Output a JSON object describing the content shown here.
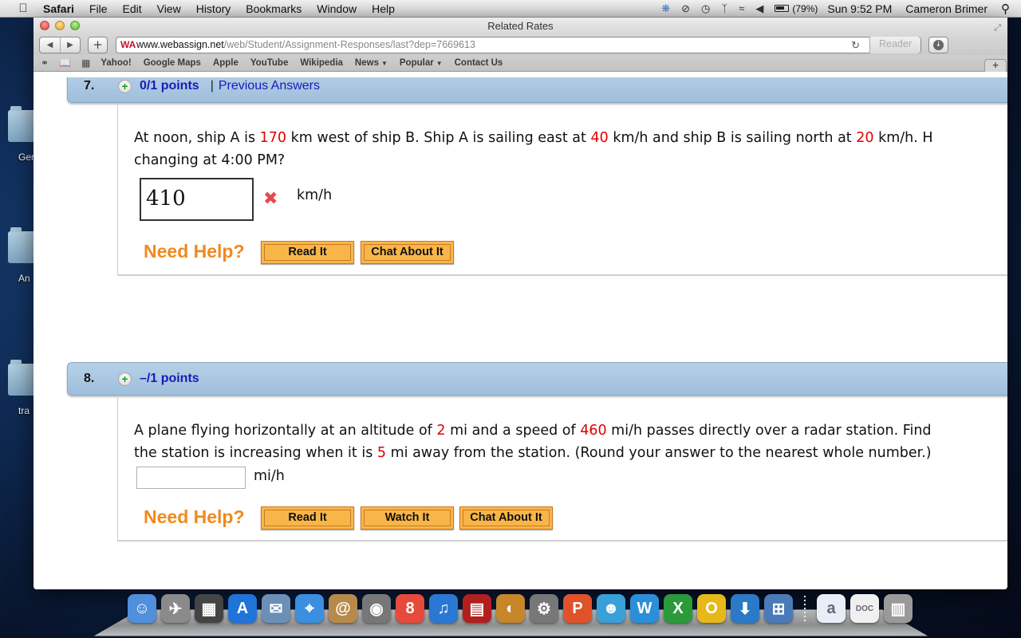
{
  "menubar": {
    "app_name": "Safari",
    "items": [
      "File",
      "Edit",
      "View",
      "History",
      "Bookmarks",
      "Window",
      "Help"
    ],
    "battery": "(79%)",
    "clock": "Sun 9:52 PM",
    "user": "Cameron Brimer"
  },
  "desktop": {
    "icons": [
      {
        "label": "Ger"
      },
      {
        "label": "An"
      },
      {
        "label": "tra"
      }
    ]
  },
  "browser": {
    "title": "Related Rates",
    "url_domain": "www.webassign.net",
    "url_path": "/web/Student/Assignment-Responses/last?dep=7669613",
    "reader_label": "Reader",
    "bookmarks": [
      {
        "label": "Yahoo!"
      },
      {
        "label": "Google Maps"
      },
      {
        "label": "Apple"
      },
      {
        "label": "YouTube"
      },
      {
        "label": "Wikipedia"
      },
      {
        "label": "News",
        "has_menu": true
      },
      {
        "label": "Popular",
        "has_menu": true
      },
      {
        "label": "Contact Us"
      }
    ]
  },
  "questions": [
    {
      "number": "7.",
      "points": "0/1 points",
      "separator": "|",
      "previous_answers": "Previous Answers",
      "text": {
        "p1": "At noon, ship A is ",
        "v1": "170",
        "p2": " km west of ship B. Ship A is sailing east at ",
        "v2": "40",
        "p3": " km/h and ship B is sailing north at ",
        "v3": "20",
        "p4": " km/h. H",
        "line2": "changing at 4:00 PM?"
      },
      "answer_value": "410",
      "answer_status": "incorrect",
      "unit": "km/h",
      "need_help": "Need Help?",
      "help_buttons": [
        "Read It",
        "Chat About It"
      ]
    },
    {
      "number": "8.",
      "points": "–/1 points",
      "text": {
        "p1": "A plane flying horizontally at an altitude of ",
        "v1": "2",
        "p2": " mi and a speed of ",
        "v2": "460",
        "p3": " mi/h passes directly over a radar station. Find",
        "l2a": "the station is increasing when it is ",
        "v3": "5",
        "l2b": " mi away from the station. (Round your answer to the nearest whole number.)"
      },
      "answer_value": "",
      "unit": "mi/h",
      "need_help": "Need Help?",
      "help_buttons": [
        "Read It",
        "Watch It",
        "Chat About It"
      ]
    }
  ],
  "dock": {
    "apps": [
      {
        "name": "Finder",
        "glyph": "☺",
        "color": "#4f8fdc"
      },
      {
        "name": "Launchpad",
        "glyph": "✈",
        "color": "#8a8a8a"
      },
      {
        "name": "Mission Control",
        "glyph": "▦",
        "color": "#444"
      },
      {
        "name": "App Store",
        "glyph": "A",
        "color": "#1e74d8"
      },
      {
        "name": "Mail",
        "glyph": "✉",
        "color": "#6c8fb8"
      },
      {
        "name": "Safari",
        "glyph": "⌖",
        "color": "#3a8fe0"
      },
      {
        "name": "Contacts",
        "glyph": "@",
        "color": "#b88a4a"
      },
      {
        "name": "FaceTime",
        "glyph": "◉",
        "color": "#777"
      },
      {
        "name": "Calendar",
        "glyph": "8",
        "color": "#e64a3a"
      },
      {
        "name": "iTunes",
        "glyph": "♫",
        "color": "#2a78d4"
      },
      {
        "name": "Photo Booth",
        "glyph": "▤",
        "color": "#b21f1f"
      },
      {
        "name": "iPhoto",
        "glyph": "◐",
        "color": "#c7862a"
      },
      {
        "name": "System Preferences",
        "glyph": "⚙",
        "color": "#777"
      },
      {
        "name": "PowerPoint",
        "glyph": "P",
        "color": "#e0522a"
      },
      {
        "name": "Messenger",
        "glyph": "☻",
        "color": "#3aa0d8"
      },
      {
        "name": "Word",
        "glyph": "W",
        "color": "#2a8fd8"
      },
      {
        "name": "Excel",
        "glyph": "X",
        "color": "#2a9a3a"
      },
      {
        "name": "Outlook",
        "glyph": "O",
        "color": "#e8b81a"
      },
      {
        "name": "Download Utility",
        "glyph": "⬇",
        "color": "#2a7ac8"
      },
      {
        "name": "Remote Desktop",
        "glyph": "⊞",
        "color": "#4a7ab8"
      }
    ],
    "documents": [
      {
        "name": "docx-file",
        "glyph": "a",
        "color": "#e8eef5"
      },
      {
        "name": "doc-file",
        "glyph": "DOC",
        "color": "#f0f0f0"
      },
      {
        "name": "Trash",
        "glyph": "▥",
        "color": "#9a9a9a"
      }
    ]
  }
}
